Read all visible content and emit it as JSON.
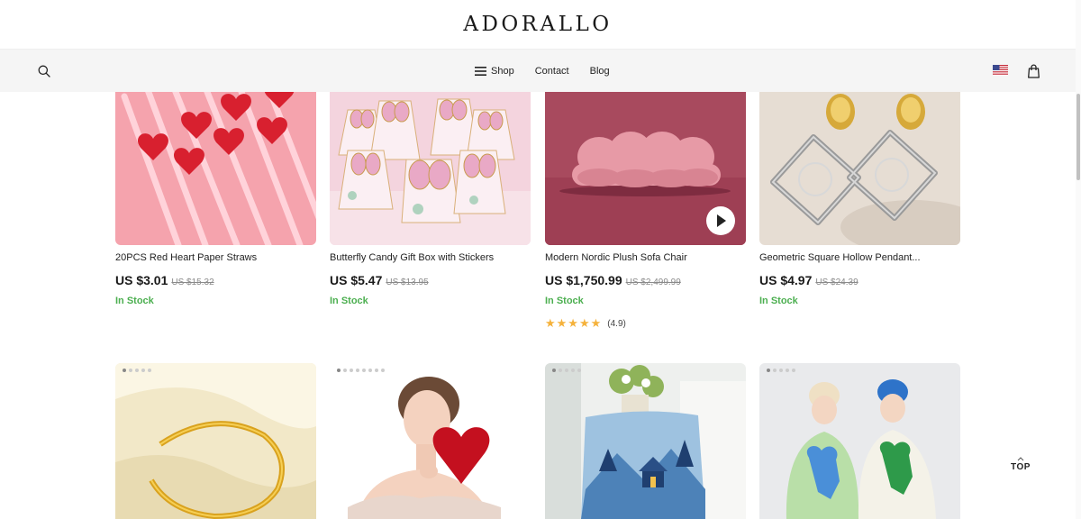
{
  "header": {
    "logo": "ADORALLO"
  },
  "nav": {
    "search_icon": "search-icon",
    "links": [
      {
        "label": "Shop",
        "icon": "menu-icon"
      },
      {
        "label": "Contact"
      },
      {
        "label": "Blog"
      }
    ],
    "flag_icon": "us-flag-icon",
    "cart_icon": "shopping-bag-icon"
  },
  "products": [
    {
      "name": "20PCS Red Heart Paper Straws",
      "price": "US $3.01",
      "old_price": "US $15.32",
      "stock": "In Stock"
    },
    {
      "name": "Butterfly Candy Gift Box with Stickers",
      "price": "US $5.47",
      "old_price": "US $13.95",
      "stock": "In Stock"
    },
    {
      "name": "Modern Nordic Plush Sofa Chair",
      "price": "US $1,750.99",
      "old_price": "US $2,499.99",
      "stock": "In Stock",
      "rating_value": 4.9,
      "rating_text": "(4.9)",
      "stars": "★★★★★",
      "has_video": true
    },
    {
      "name": "Geometric Square Hollow Pendant...",
      "price": "US $4.97",
      "old_price": "US $24.39",
      "stock": "In Stock"
    }
  ],
  "products_row2": [
    {
      "image": "gold bamboo cuff bracelet on silk"
    },
    {
      "image": "woman holding red heart bag"
    },
    {
      "image": "winter cabin pillow cover"
    },
    {
      "image": "couple in bear sweaters"
    }
  ],
  "back_to_top": {
    "label": "TOP"
  },
  "colors": {
    "in_stock": "#4caf50",
    "star": "#f5b23c",
    "nav_bg": "#f5f5f5"
  }
}
